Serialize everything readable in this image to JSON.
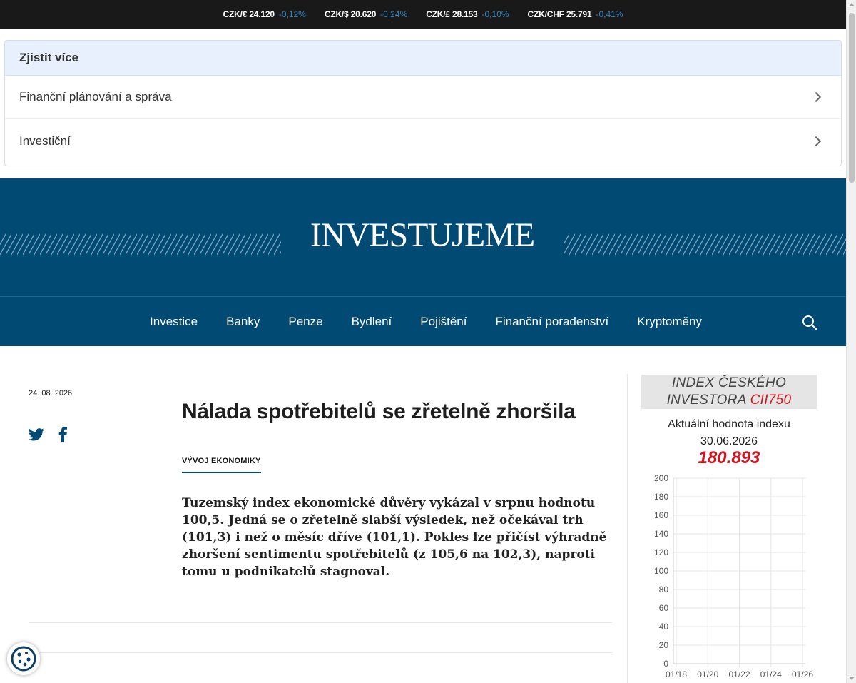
{
  "ticker": [
    {
      "pair": "CZK/€ 24.120",
      "change": "-0,12%"
    },
    {
      "pair": "CZK/$ 20.620",
      "change": "-0,24%"
    },
    {
      "pair": "CZK/£ 28.153",
      "change": "-0,10%"
    },
    {
      "pair": "CZK/CHF 25.791",
      "change": "-0,41%"
    }
  ],
  "learn_more": {
    "heading": "Zjistit více",
    "items": [
      "Finanční plánování a správa",
      "Investiční"
    ]
  },
  "brand": {
    "logo": "INVESTUJEME"
  },
  "nav": {
    "items": [
      "Investice",
      "Banky",
      "Penze",
      "Bydlení",
      "Pojištění",
      "Finanční poradenství",
      "Kryptoměny"
    ]
  },
  "article": {
    "date": "24. 08. 2026",
    "title": "Nálada spotřebitelů se zřetelně zhoršila",
    "category": "VÝVOJ EKONOMIKY",
    "perex": "Tuzemský index ekonomické důvěry vykázal v srpnu hodnotu 100,5. Jedná se o zřetelně slabší výsledek, než očekával trh (101,3) i než o měsíc dříve (101,1). Pokles lze přičíst výhradně zhoršení sentimentu spotřebitelů (z 105,6 na 102,3), naproti tomu u podnikatelů stagnoval."
  },
  "index_widget": {
    "title_line1": "INDEX ČESKÉHO",
    "title_line2": "INVESTORA ",
    "title_code": "CII750",
    "subtitle": "Aktuální hodnota indexu",
    "date": "30.06.2026",
    "value": "180.893"
  },
  "chart_data": {
    "type": "line",
    "title": "",
    "xlabel": "",
    "ylabel": "",
    "x": [
      "01/18",
      "01/20",
      "01/22",
      "01/24",
      "01/26"
    ],
    "yticks": [
      0,
      20,
      40,
      60,
      80,
      100,
      120,
      140,
      160,
      180,
      200
    ],
    "ylim": [
      0,
      200
    ],
    "series": [],
    "grid": true
  },
  "colors": {
    "brand_blue": "#004a74",
    "accent_red": "#d0161e",
    "ticker_change": "#2f86c4",
    "learn_head_bg": "#e8f0fe"
  },
  "icons": {
    "twitter": "twitter-icon",
    "facebook": "facebook-icon",
    "search": "search-icon",
    "chevron": "chevron-right-icon",
    "cookie": "cookie-icon"
  }
}
